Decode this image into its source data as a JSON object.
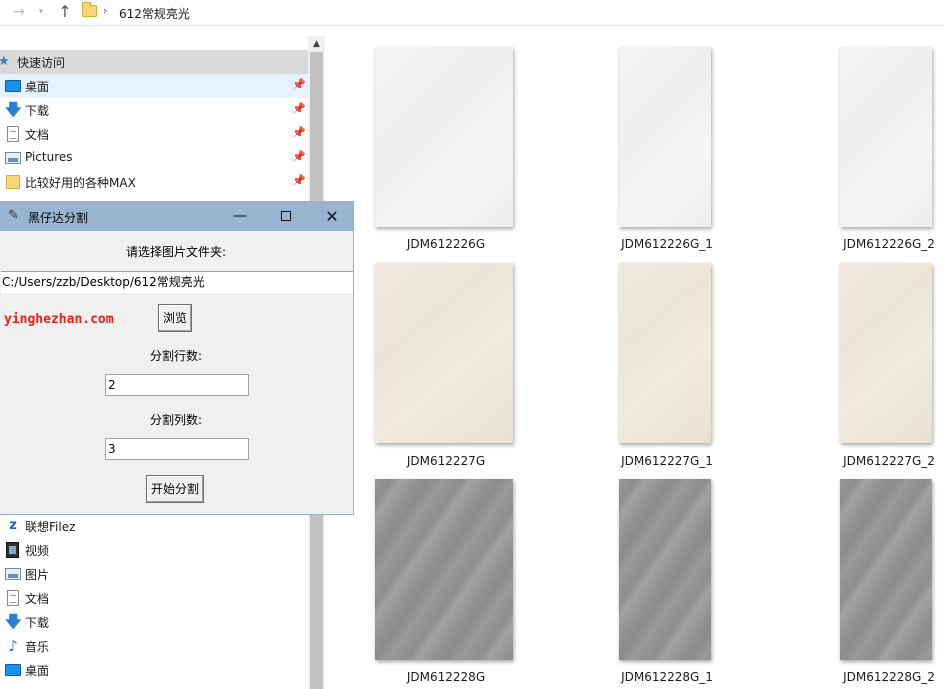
{
  "address_bar": {
    "forward_icon": "arrow-right-icon",
    "history_icon": "chevron-down-icon",
    "up_icon": "arrow-up-icon",
    "folder_icon": "folder-icon",
    "separator": "›",
    "path": "612常规亮光"
  },
  "nav_pane": {
    "quick_access": "快速访问",
    "pinned": [
      {
        "label": "桌面",
        "icon": "desktop-icon"
      },
      {
        "label": "下载",
        "icon": "download-icon"
      },
      {
        "label": "文档",
        "icon": "document-icon"
      },
      {
        "label": "Pictures",
        "icon": "pictures-icon"
      },
      {
        "label": "比较好用的各种MAX",
        "icon": "folder-icon"
      }
    ],
    "pc_items": [
      {
        "label": "联想Filez",
        "icon": "filez-icon"
      },
      {
        "label": "视频",
        "icon": "video-icon"
      },
      {
        "label": "图片",
        "icon": "pictures-icon"
      },
      {
        "label": "文档",
        "icon": "document-icon"
      },
      {
        "label": "下载",
        "icon": "download-icon"
      },
      {
        "label": "音乐",
        "icon": "music-icon"
      },
      {
        "label": "桌面",
        "icon": "desktop-icon"
      }
    ]
  },
  "files": [
    {
      "name": "JDM612226G",
      "tone": "white"
    },
    {
      "name": "JDM612226G_1",
      "tone": "white"
    },
    {
      "name": "JDM612226G_2",
      "tone": "white"
    },
    {
      "name": "JDM612227G",
      "tone": "cream"
    },
    {
      "name": "JDM612227G_1",
      "tone": "cream"
    },
    {
      "name": "JDM612227G_2",
      "tone": "cream"
    },
    {
      "name": "JDM612228G",
      "tone": "gray"
    },
    {
      "name": "JDM612228G_1",
      "tone": "gray"
    },
    {
      "name": "JDM612228G_2",
      "tone": "gray"
    }
  ],
  "dialog": {
    "title": "黑仔达分割",
    "feather_icon": "feather-icon",
    "minimize": "—",
    "close": "✕",
    "prompt": "请选择图片文件夹:",
    "path_value": "C:/Users/zzb/Desktop/612常规亮光",
    "site": "yinghezhan.com",
    "browse_label": "浏览",
    "rows_label": "分割行数:",
    "rows_value": "2",
    "cols_label": "分割列数:",
    "cols_value": "3",
    "start_label": "开始分割"
  },
  "colors": {
    "title_bar": "#99b4d1",
    "site_text": "#e2231a",
    "selection": "#e5f3ff"
  }
}
